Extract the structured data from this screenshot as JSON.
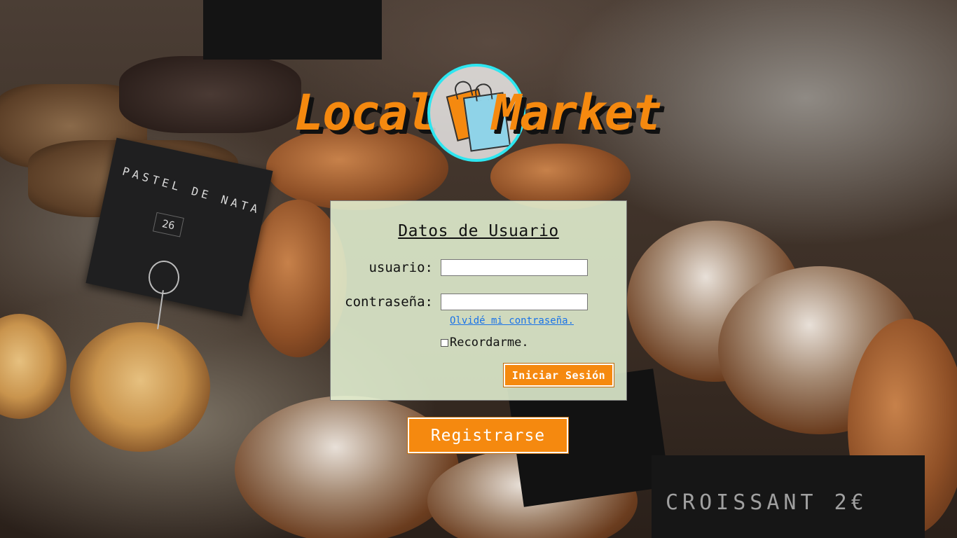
{
  "logo": {
    "word_left": "Local",
    "word_right": "Market",
    "accent_color": "#f5890f",
    "ring_color": "#2ee6f0",
    "icon": "shopping-bags-icon"
  },
  "background": {
    "sign_text": "PASTEL DE NATA",
    "sign_number": "26",
    "bottom_sign_text": "CROISSANT 2€"
  },
  "login_form": {
    "title": "Datos de Usuario",
    "username_label": "usuario:",
    "username_value": "",
    "password_label": "contraseña:",
    "password_value": "",
    "forgot_link": "Olvidé mi contraseña.",
    "remember_label": "Recordarme.",
    "remember_checked": false,
    "submit_label": "Iniciar Sesión"
  },
  "register_button": "Registrarse"
}
